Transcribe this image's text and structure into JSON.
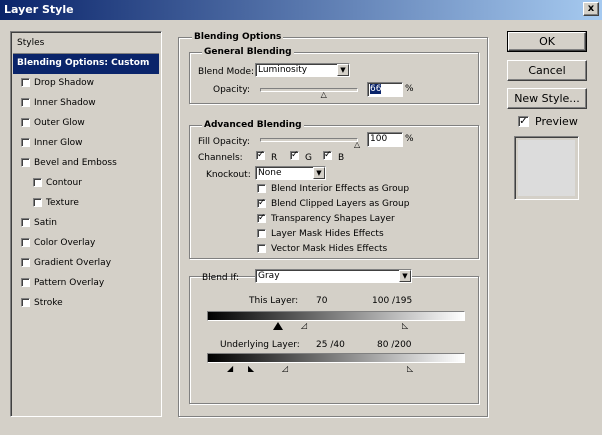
{
  "window": {
    "title": "Layer Style",
    "close_glyph": "x"
  },
  "styles_list": {
    "header": "Styles",
    "items": [
      {
        "label": "Blending Options: Custom",
        "selected": true
      },
      {
        "label": "Drop Shadow",
        "checked": false
      },
      {
        "label": "Inner Shadow",
        "checked": false
      },
      {
        "label": "Outer Glow",
        "checked": false
      },
      {
        "label": "Inner Glow",
        "checked": false
      },
      {
        "label": "Bevel and Emboss",
        "checked": false
      },
      {
        "label": "Contour",
        "checked": false
      },
      {
        "label": "Texture",
        "checked": false
      },
      {
        "label": "Satin",
        "checked": false
      },
      {
        "label": "Color Overlay",
        "checked": false
      },
      {
        "label": "Gradient Overlay",
        "checked": false
      },
      {
        "label": "Pattern Overlay",
        "checked": false
      },
      {
        "label": "Stroke",
        "checked": false
      }
    ]
  },
  "blending": {
    "section_title": "Blending Options",
    "general": {
      "title": "General Blending",
      "blend_mode_label": "Blend Mode:",
      "blend_mode_value": "Luminosity",
      "opacity_label": "Opacity:",
      "opacity_value": "66",
      "opacity_unit": "%",
      "opacity_fraction": 0.66
    },
    "advanced": {
      "title": "Advanced Blending",
      "fill_opacity_label": "Fill Opacity:",
      "fill_opacity_value": "100",
      "fill_opacity_unit": "%",
      "fill_opacity_fraction": 1.0,
      "channels_label": "Channels:",
      "channel_r": "R",
      "channel_g": "G",
      "channel_b": "B",
      "knockout_label": "Knockout:",
      "knockout_value": "None",
      "opt_interior": "Blend Interior Effects as Group",
      "opt_clipped": "Blend Clipped Layers as Group",
      "opt_transparency": "Transparency Shapes Layer",
      "opt_layer_mask": "Layer Mask Hides Effects",
      "opt_vector_mask": "Vector Mask Hides Effects",
      "checked": {
        "r": true,
        "g": true,
        "b": true,
        "interior": false,
        "clipped": true,
        "transparency": true,
        "layer_mask": false,
        "vector_mask": false
      }
    },
    "blend_if": {
      "label": "Blend If:",
      "value": "Gray",
      "this_layer_label": "This Layer:",
      "this_layer_low": "70",
      "this_layer_high": "100 /195",
      "underlying_label": "Underlying Layer:",
      "underlying_low": "25 /40",
      "underlying_high": "80 /200"
    }
  },
  "buttons": {
    "ok": "OK",
    "cancel": "Cancel",
    "new_style": "New Style...",
    "preview_label": "Preview",
    "preview_checked": true
  }
}
